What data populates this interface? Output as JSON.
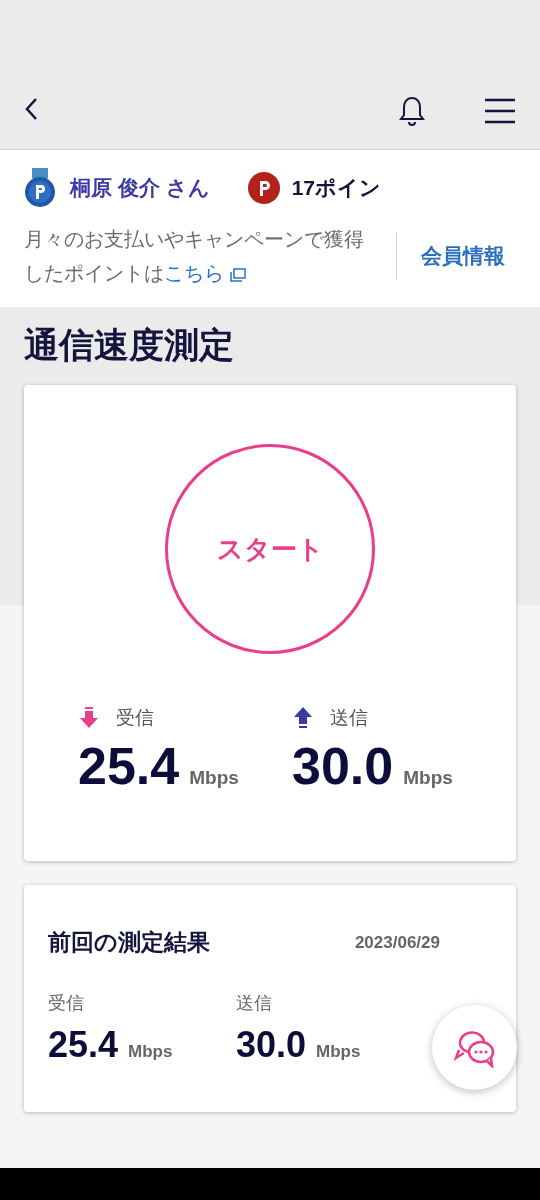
{
  "member": {
    "name": "桐原 俊介 さん",
    "points": "17ポイン",
    "note": "月々のお支払いやキャンペーンで獲得したポイントは",
    "note_link": "こちら",
    "info_link": "会員情報"
  },
  "title": "通信速度測定",
  "speed_test": {
    "start_button": "スタート",
    "results": [
      {
        "kind": "download",
        "label": "受信",
        "value": "25.4",
        "unit": "Mbps"
      },
      {
        "kind": "upload",
        "label": "送信",
        "value": "30.0",
        "unit": "Mbps"
      }
    ]
  },
  "previous": {
    "title": "前回の測定結果",
    "date": "2023/06/29",
    "results": [
      {
        "label": "受信",
        "value": "25.4",
        "unit": "Mbps"
      },
      {
        "label": "送信",
        "value": "30.0",
        "unit": "Mbps"
      }
    ]
  }
}
